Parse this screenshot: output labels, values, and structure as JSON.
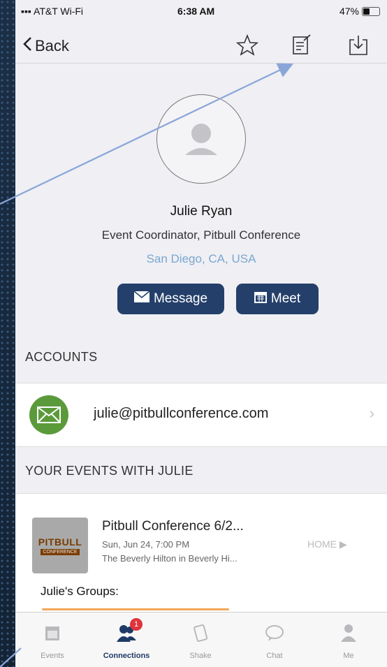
{
  "status": {
    "carrier": "AT&T Wi-Fi",
    "time": "6:38 AM",
    "battery": "47%",
    "battery_level": 0.47
  },
  "nav": {
    "back_label": "Back"
  },
  "profile": {
    "name": "Julie Ryan",
    "title": "Event Coordinator, Pitbull Conference",
    "location": "San Diego, CA, USA",
    "message_label": "Message",
    "meet_label": "Meet"
  },
  "accounts": {
    "header": "ACCOUNTS",
    "email": "julie@pitbullconference.com"
  },
  "events": {
    "header": "YOUR EVENTS WITH JULIE",
    "items": [
      {
        "logo_line1": "PITBULL",
        "logo_line2": "CONFERENCE",
        "title": "Pitbull Conference 6/2...",
        "date": "Sun, Jun 24, 7:00 PM",
        "venue": "The Beverly Hilton in Beverly Hi...",
        "action": "HOME ▶"
      }
    ],
    "groups_label": "Julie's Groups:"
  },
  "tabs": [
    {
      "label": "Events",
      "icon": "calendar-icon"
    },
    {
      "label": "Connections",
      "icon": "people-icon",
      "badge": "1",
      "active": true
    },
    {
      "label": "Shake",
      "icon": "shake-icon"
    },
    {
      "label": "Chat",
      "icon": "chat-icon"
    },
    {
      "label": "Me",
      "icon": "person-icon"
    }
  ],
  "colors": {
    "accent": "#24406a",
    "link": "#7aa7d0",
    "account_icon": "#5b9a3b",
    "badge": "#e0343c",
    "annotation_arrow": "#8aa6d8"
  }
}
